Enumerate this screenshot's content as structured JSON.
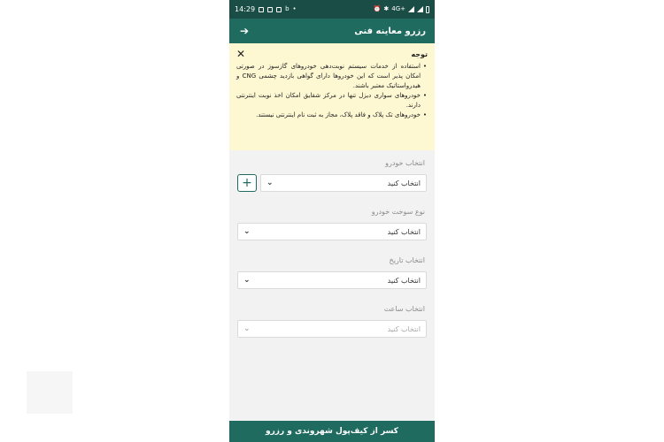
{
  "statusbar": {
    "time": "14:29",
    "network": "4G+"
  },
  "appbar": {
    "title": "رزرو معاینه فنی"
  },
  "notice": {
    "title": "توجه",
    "items": [
      "استفاده از خدمات سیستم نوبت‌دهی خودروهای گازسوز در صورتی امکان پذیر است که این خودروها دارای گواهی بازدید چشمی CNG و هیدرواستاتیک معتبر باشند.",
      "خودروهای سواری دیزل تنها در مرکز شقایق امکان اخذ نوبت اینترنتی دارند.",
      "خودروهای تک پلاک و فاقد پلاک، مجاز به ثبت نام اینترنتی نیستند."
    ]
  },
  "form": {
    "vehicle": {
      "label": "انتخاب خودرو",
      "value": "انتخاب کنید"
    },
    "fuel": {
      "label": "نوع سوخت خودرو",
      "value": "انتخاب کنید"
    },
    "date": {
      "label": "انتخاب تاریخ",
      "value": "انتخاب کنید"
    },
    "time": {
      "label": "انتخاب ساعت",
      "value": "انتخاب کنید"
    }
  },
  "bottom_button": {
    "label": "کسر از کیف‌پول شهروندی و رزرو"
  },
  "colors": {
    "primary": "#1f6b5f",
    "statusbar": "#1a4d45",
    "notice_bg": "#fdf7d2"
  }
}
